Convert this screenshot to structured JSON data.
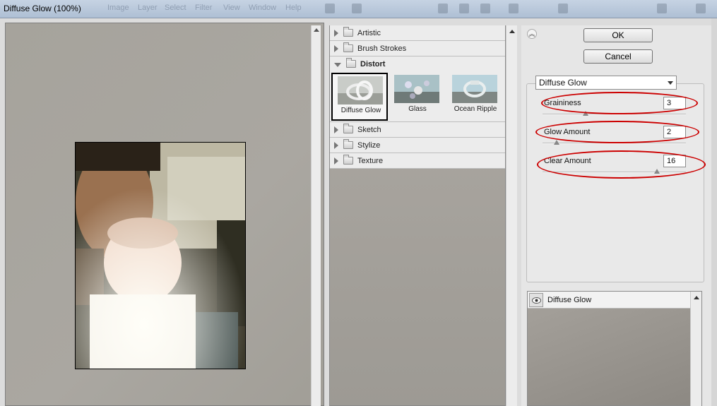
{
  "window": {
    "title": "Diffuse Glow (100%)",
    "ghost_menu": [
      "Image",
      "Layer",
      "Select",
      "Filter",
      "View",
      "Window",
      "Help"
    ]
  },
  "gallery": {
    "categories_top": [
      {
        "label": "Artistic",
        "expanded": false
      },
      {
        "label": "Brush Strokes",
        "expanded": false
      },
      {
        "label": "Distort",
        "expanded": true
      }
    ],
    "thumbnails": [
      {
        "label": "Diffuse Glow",
        "selected": true
      },
      {
        "label": "Glass",
        "selected": false
      },
      {
        "label": "Ocean Ripple",
        "selected": false
      }
    ],
    "categories_bottom": [
      {
        "label": "Sketch",
        "expanded": false
      },
      {
        "label": "Stylize",
        "expanded": false
      },
      {
        "label": "Texture",
        "expanded": false
      }
    ]
  },
  "controls": {
    "ok_label": "OK",
    "cancel_label": "Cancel",
    "filter_select": "Diffuse Glow",
    "params": [
      {
        "label": "Graininess",
        "value": "3",
        "fraction": 0.3
      },
      {
        "label": "Glow Amount",
        "value": "2",
        "fraction": 0.1
      },
      {
        "label": "Clear Amount",
        "value": "16",
        "fraction": 0.8
      }
    ],
    "highlight_color": "#cc0000"
  },
  "layers": {
    "items": [
      {
        "label": "Diffuse Glow",
        "visible": true
      }
    ]
  }
}
